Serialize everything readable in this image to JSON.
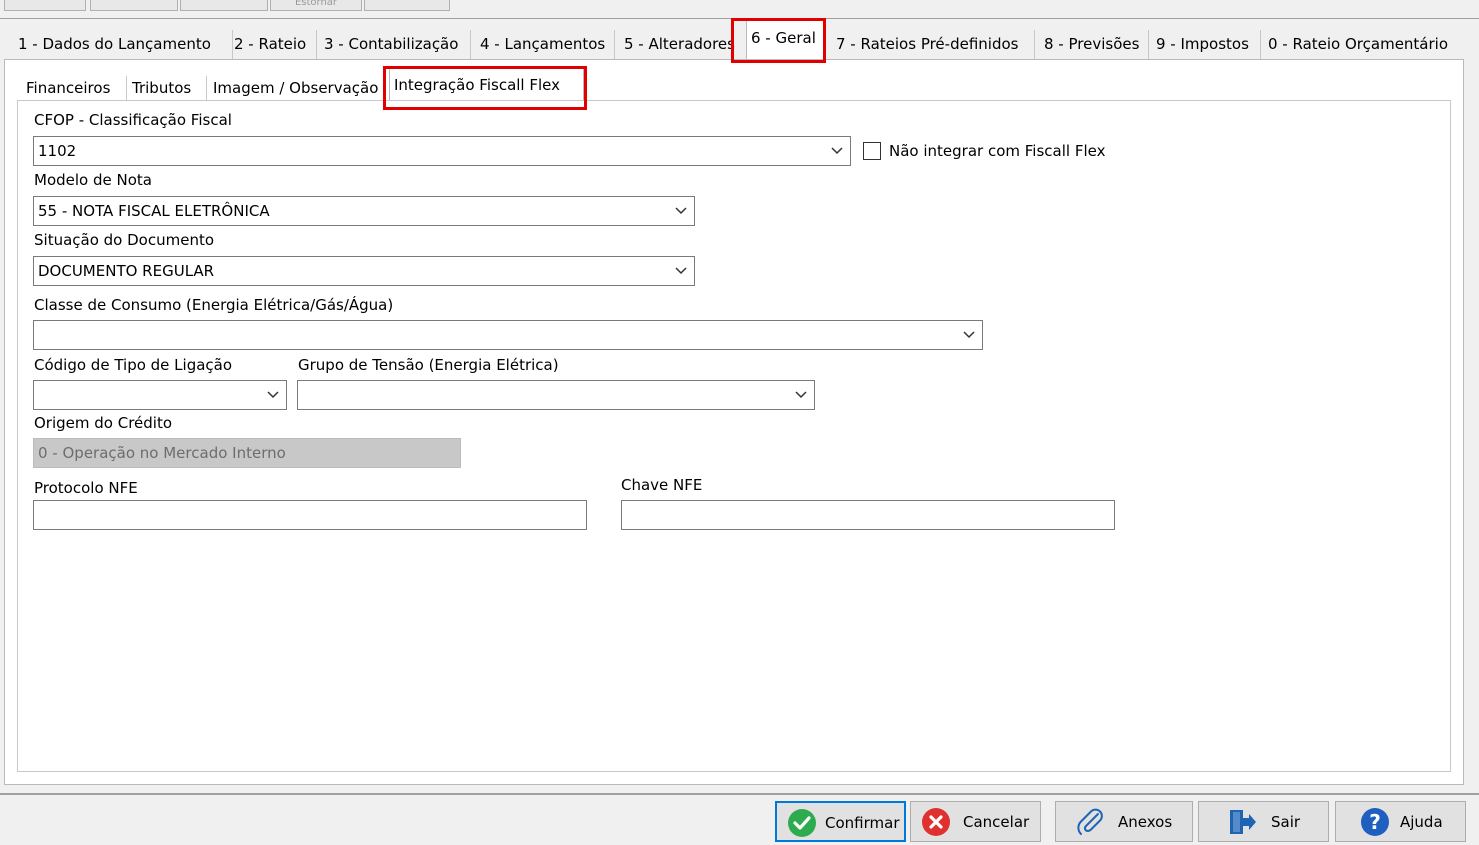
{
  "top_toolbar": {
    "stub_label": "Estornar"
  },
  "main_tabs": [
    {
      "label": "1 - Dados do Lançamento"
    },
    {
      "label": "2 - Rateio"
    },
    {
      "label": "3 - Contabilização"
    },
    {
      "label": "4 - Lançamentos"
    },
    {
      "label": "5 - Alteradores"
    },
    {
      "label": "6 - Geral",
      "active": true
    },
    {
      "label": "7 - Rateios Pré-definidos"
    },
    {
      "label": "8 - Previsões"
    },
    {
      "label": "9 - Impostos"
    },
    {
      "label": "0 - Rateio Orçamentário"
    }
  ],
  "sub_tabs": [
    {
      "label": "Financeiros"
    },
    {
      "label": "Tributos"
    },
    {
      "label": "Imagem / Observação"
    },
    {
      "label": "Integração Fiscall Flex",
      "active": true
    }
  ],
  "form": {
    "cfop": {
      "label": "CFOP - Classificação Fiscal",
      "value": "1102"
    },
    "nao_integrar": {
      "label": "Não integrar com Fiscall Flex",
      "checked": false
    },
    "modelo_nota": {
      "label": "Modelo de Nota",
      "value": "55 - NOTA FISCAL ELETRÔNICA"
    },
    "situacao_documento": {
      "label": "Situação do Documento",
      "value": "DOCUMENTO REGULAR"
    },
    "classe_consumo": {
      "label": "Classe de Consumo (Energia Elétrica/Gás/Água)",
      "value": ""
    },
    "codigo_tipo_ligacao": {
      "label": "Código de Tipo de Ligação",
      "value": ""
    },
    "grupo_tensao": {
      "label": "Grupo de Tensão (Energia Elétrica)",
      "value": ""
    },
    "origem_credito": {
      "label": "Origem do Crédito",
      "value": "0 - Operação no Mercado Interno"
    },
    "protocolo_nfe": {
      "label": "Protocolo NFE",
      "value": ""
    },
    "chave_nfe": {
      "label": "Chave NFE",
      "value": ""
    }
  },
  "buttons": {
    "confirmar": "Confirmar",
    "cancelar": "Cancelar",
    "anexos": "Anexos",
    "sair": "Sair",
    "ajuda": "Ajuda"
  },
  "colors": {
    "highlight": "#e00000",
    "confirm_green": "#2eab4f",
    "cancel_red": "#e03131",
    "help_blue": "#1f5fbf",
    "icon_blue": "#1e64b4",
    "disabled_bg": "#c8c8c8"
  }
}
